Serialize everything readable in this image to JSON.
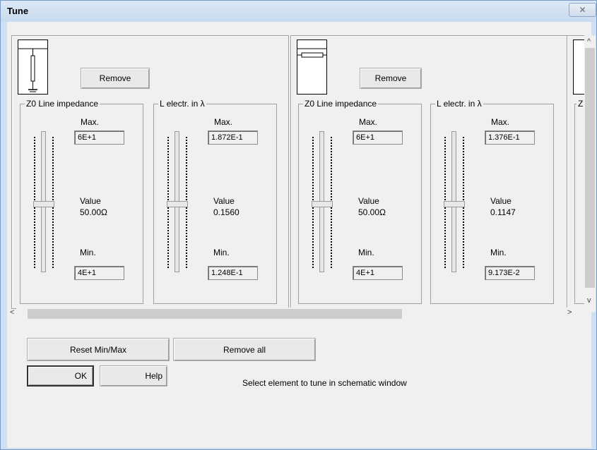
{
  "window": {
    "title": "Tune",
    "close_symbol": "✕"
  },
  "elements": [
    {
      "symbol": "vertical-line",
      "remove_label": "Remove",
      "params": [
        {
          "title": "Z0 Line impedance",
          "max_label": "Max.",
          "max_value": "6E+1",
          "value_label": "Value",
          "value": "50.00Ω",
          "min_label": "Min.",
          "min_value": "4E+1"
        },
        {
          "title": "L electr. in λ",
          "max_label": "Max.",
          "max_value": "1.872E-1",
          "value_label": "Value",
          "value": "0.1560",
          "min_label": "Min.",
          "min_value": "1.248E-1"
        }
      ]
    },
    {
      "symbol": "horizontal-line",
      "remove_label": "Remove",
      "params": [
        {
          "title": "Z0 Line impedance",
          "max_label": "Max.",
          "max_value": "6E+1",
          "value_label": "Value",
          "value": "50.00Ω",
          "min_label": "Min.",
          "min_value": "4E+1"
        },
        {
          "title": "L electr. in λ",
          "max_label": "Max.",
          "max_value": "1.376E-1",
          "value_label": "Value",
          "value": "0.1147",
          "min_label": "Min.",
          "min_value": "9.173E-2"
        }
      ]
    }
  ],
  "partial_group_title": "Z",
  "buttons": {
    "reset": "Reset Min/Max",
    "remove_all": "Remove all",
    "ok": "OK",
    "help": "Help"
  },
  "status": "Select element to tune in schematic window",
  "scroll": {
    "up": "^",
    "down": "v",
    "left": "<",
    "right": ">"
  }
}
